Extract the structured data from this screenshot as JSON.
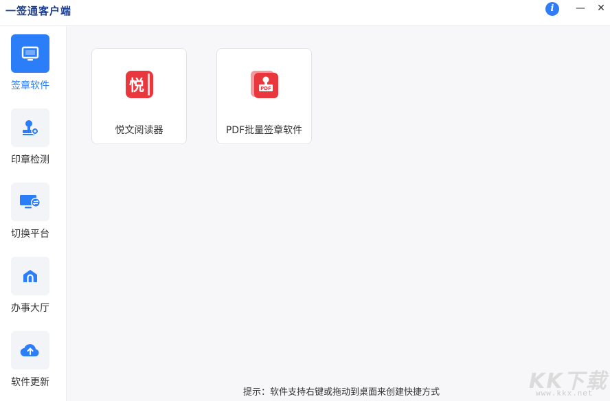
{
  "app": {
    "title": "一签通客户端"
  },
  "window_controls": {
    "info": "i",
    "minimize": "—",
    "close": "✕"
  },
  "sidebar": {
    "items": [
      {
        "label": "签章软件",
        "icon": "monitor-icon",
        "active": true
      },
      {
        "label": "印章检测",
        "icon": "seal-search-icon",
        "active": false
      },
      {
        "label": "切换平台",
        "icon": "screen-switch-icon",
        "active": false
      },
      {
        "label": "办事大厅",
        "icon": "home-icon",
        "active": false
      },
      {
        "label": "软件更新",
        "icon": "cloud-upload-icon",
        "active": false
      }
    ]
  },
  "apps": [
    {
      "label": "悦文阅读器",
      "icon": "yuewen-reader-icon",
      "glyph": "悦"
    },
    {
      "label": "PDF批量签章软件",
      "icon": "pdf-batch-sign-icon",
      "glyph": "PDF"
    }
  ],
  "hint": "提示：软件支持右键或拖动到桌面来创建快捷方式",
  "watermark": {
    "big": "KK下载",
    "small": "www.kkx.net"
  },
  "colors": {
    "accent": "#2c7ef8",
    "title": "#1a3d8f",
    "app_red": "#e8383d"
  }
}
